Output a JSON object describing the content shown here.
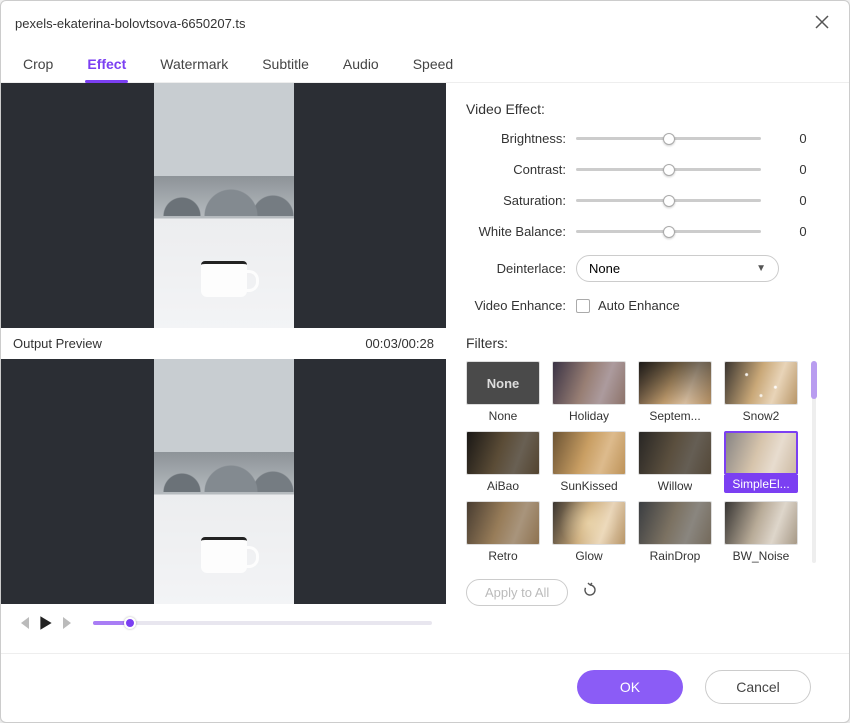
{
  "window": {
    "title": "pexels-ekaterina-bolovtsova-6650207.ts"
  },
  "tabs": [
    "Crop",
    "Effect",
    "Watermark",
    "Subtitle",
    "Audio",
    "Speed"
  ],
  "active_tab_index": 1,
  "preview": {
    "label": "Output Preview",
    "time": "00:03/00:28"
  },
  "video_effect": {
    "title": "Video Effect:",
    "sliders": [
      {
        "label": "Brightness:",
        "value": 0,
        "pos": 50
      },
      {
        "label": "Contrast:",
        "value": 0,
        "pos": 50
      },
      {
        "label": "Saturation:",
        "value": 0,
        "pos": 50
      },
      {
        "label": "White Balance:",
        "value": 0,
        "pos": 50
      }
    ],
    "deinterlace": {
      "label": "Deinterlace:",
      "value": "None"
    },
    "enhance": {
      "label": "Video Enhance:",
      "checkbox_label": "Auto Enhance",
      "checked": false
    }
  },
  "filters": {
    "title": "Filters:",
    "items": [
      {
        "label": "None",
        "none": true
      },
      {
        "label": "Holiday",
        "tint": "tint-holiday"
      },
      {
        "label": "Septem...",
        "tint": "tint-sept"
      },
      {
        "label": "Snow2",
        "tint": "tint-snow"
      },
      {
        "label": "AiBao",
        "tint": "tint-aibao"
      },
      {
        "label": "SunKissed",
        "tint": "tint-sun"
      },
      {
        "label": "Willow",
        "tint": "tint-willow"
      },
      {
        "label": "SimpleEl...",
        "tint": "tint-simple",
        "selected": true
      },
      {
        "label": "Retro",
        "tint": "tint-retro"
      },
      {
        "label": "Glow",
        "tint": "tint-glow"
      },
      {
        "label": "RainDrop",
        "tint": "tint-rain"
      },
      {
        "label": "BW_Noise",
        "tint": "tint-bw"
      }
    ],
    "apply_all": "Apply to All"
  },
  "footer": {
    "ok": "OK",
    "cancel": "Cancel"
  }
}
